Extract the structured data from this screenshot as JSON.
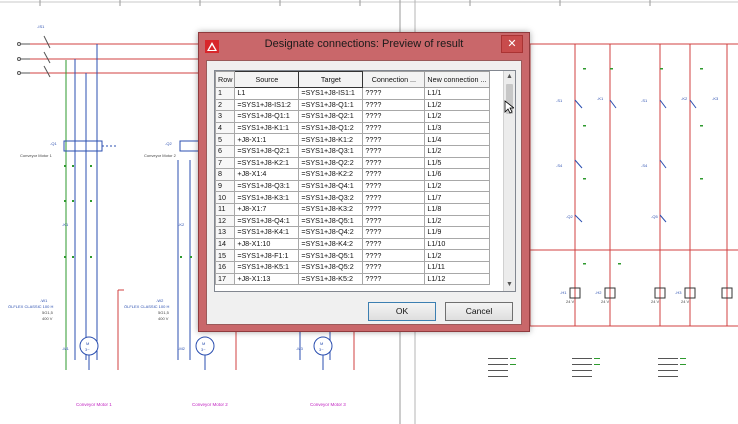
{
  "dialog": {
    "title": "Designate connections: Preview of result",
    "close_glyph": "✕",
    "columns": [
      "Row",
      "Source",
      "Target",
      "Connection ...",
      "New connection ..."
    ],
    "rows": [
      {
        "row": "1",
        "source": "L1",
        "target": "=SYS1+J8-IS1:1",
        "connection": "????",
        "new_connection": "L1/1"
      },
      {
        "row": "2",
        "source": "=SYS1+J8-IS1:2",
        "target": "=SYS1+J8-Q1:1",
        "connection": "????",
        "new_connection": "L1/2"
      },
      {
        "row": "3",
        "source": "=SYS1+J8-Q1:1",
        "target": "=SYS1+J8-Q2:1",
        "connection": "????",
        "new_connection": "L1/2"
      },
      {
        "row": "4",
        "source": "=SYS1+J8-K1:1",
        "target": "=SYS1+J8-Q1:2",
        "connection": "????",
        "new_connection": "L1/3"
      },
      {
        "row": "5",
        "source": "+J8-X1:1",
        "target": "=SYS1+J8-K1:2",
        "connection": "????",
        "new_connection": "L1/4"
      },
      {
        "row": "6",
        "source": "=SYS1+J8-Q2:1",
        "target": "=SYS1+J8-Q3:1",
        "connection": "????",
        "new_connection": "L1/2"
      },
      {
        "row": "7",
        "source": "=SYS1+J8-K2:1",
        "target": "=SYS1+J8-Q2:2",
        "connection": "????",
        "new_connection": "L1/5"
      },
      {
        "row": "8",
        "source": "+J8-X1:4",
        "target": "=SYS1+J8-K2:2",
        "connection": "????",
        "new_connection": "L1/6"
      },
      {
        "row": "9",
        "source": "=SYS1+J8-Q3:1",
        "target": "=SYS1+J8-Q4:1",
        "connection": "????",
        "new_connection": "L1/2"
      },
      {
        "row": "10",
        "source": "=SYS1+J8-K3:1",
        "target": "=SYS1+J8-Q3:2",
        "connection": "????",
        "new_connection": "L1/7"
      },
      {
        "row": "11",
        "source": "+J8-X1:7",
        "target": "=SYS1+J8-K3:2",
        "connection": "????",
        "new_connection": "L1/8"
      },
      {
        "row": "12",
        "source": "=SYS1+J8-Q4:1",
        "target": "=SYS1+J8-Q5:1",
        "connection": "????",
        "new_connection": "L1/2"
      },
      {
        "row": "13",
        "source": "=SYS1+J8-K4:1",
        "target": "=SYS1+J8-Q4:2",
        "connection": "????",
        "new_connection": "L1/9"
      },
      {
        "row": "14",
        "source": "+J8-X1:10",
        "target": "=SYS1+J8-K4:2",
        "connection": "????",
        "new_connection": "L1/10"
      },
      {
        "row": "15",
        "source": "=SYS1+J8-F1:1",
        "target": "=SYS1+J8-Q5:1",
        "connection": "????",
        "new_connection": "L1/2"
      },
      {
        "row": "16",
        "source": "=SYS1+J8-K5:1",
        "target": "=SYS1+J8-Q5:2",
        "connection": "????",
        "new_connection": "L1/11"
      },
      {
        "row": "17",
        "source": "+J8-X1:13",
        "target": "=SYS1+J8-K5:2",
        "connection": "????",
        "new_connection": "L1/12"
      }
    ],
    "ok_label": "OK",
    "cancel_label": "Cancel"
  },
  "schematic": {
    "top_labels": [
      "-IS1",
      "-F1"
    ],
    "conveyor_labels": [
      {
        "id": "-Q1",
        "text": "Conveyor Motor 1"
      },
      {
        "id": "-Q2",
        "text": "Conveyor Motor 2"
      },
      {
        "id": "-Q3",
        "text": "Conveyor Motor 3"
      }
    ],
    "k_labels": [
      "-K1",
      "-K2",
      "-K3"
    ],
    "cable_labels": [
      {
        "id": "-W1",
        "text": "ÖLFLEX CLASSIC 100 H",
        "spec": "5G1,5",
        "voltage": "400 V"
      },
      {
        "id": "-W2",
        "text": "ÖLFLEX CLASSIC 100 H",
        "spec": "5G1,5",
        "voltage": "400 V"
      }
    ],
    "motor_labels": [
      {
        "id": "-M1",
        "caption": "Conveyor Motor 1"
      },
      {
        "id": "-M2",
        "caption": "Conveyor Motor 2"
      },
      {
        "id": "-M3",
        "caption": "Conveyor Motor 3"
      }
    ],
    "motor_symbol": "M",
    "motor_phase": "3~",
    "right_labels": [
      "-S1",
      "-K1",
      "-S4",
      "-K2",
      "-S1",
      "-K3",
      "-S4",
      "-Q2",
      "-Q5",
      "-H1",
      "-H2",
      "-H3"
    ],
    "lamp_voltage": "24 V",
    "section_label": "-24V"
  },
  "colors": {
    "dialog_frame": "#c9676a",
    "wire_red": "#d04040",
    "wire_green": "#2e9a2e",
    "wire_blue": "#2b4fb0",
    "caption_magenta": "#c020c0"
  }
}
